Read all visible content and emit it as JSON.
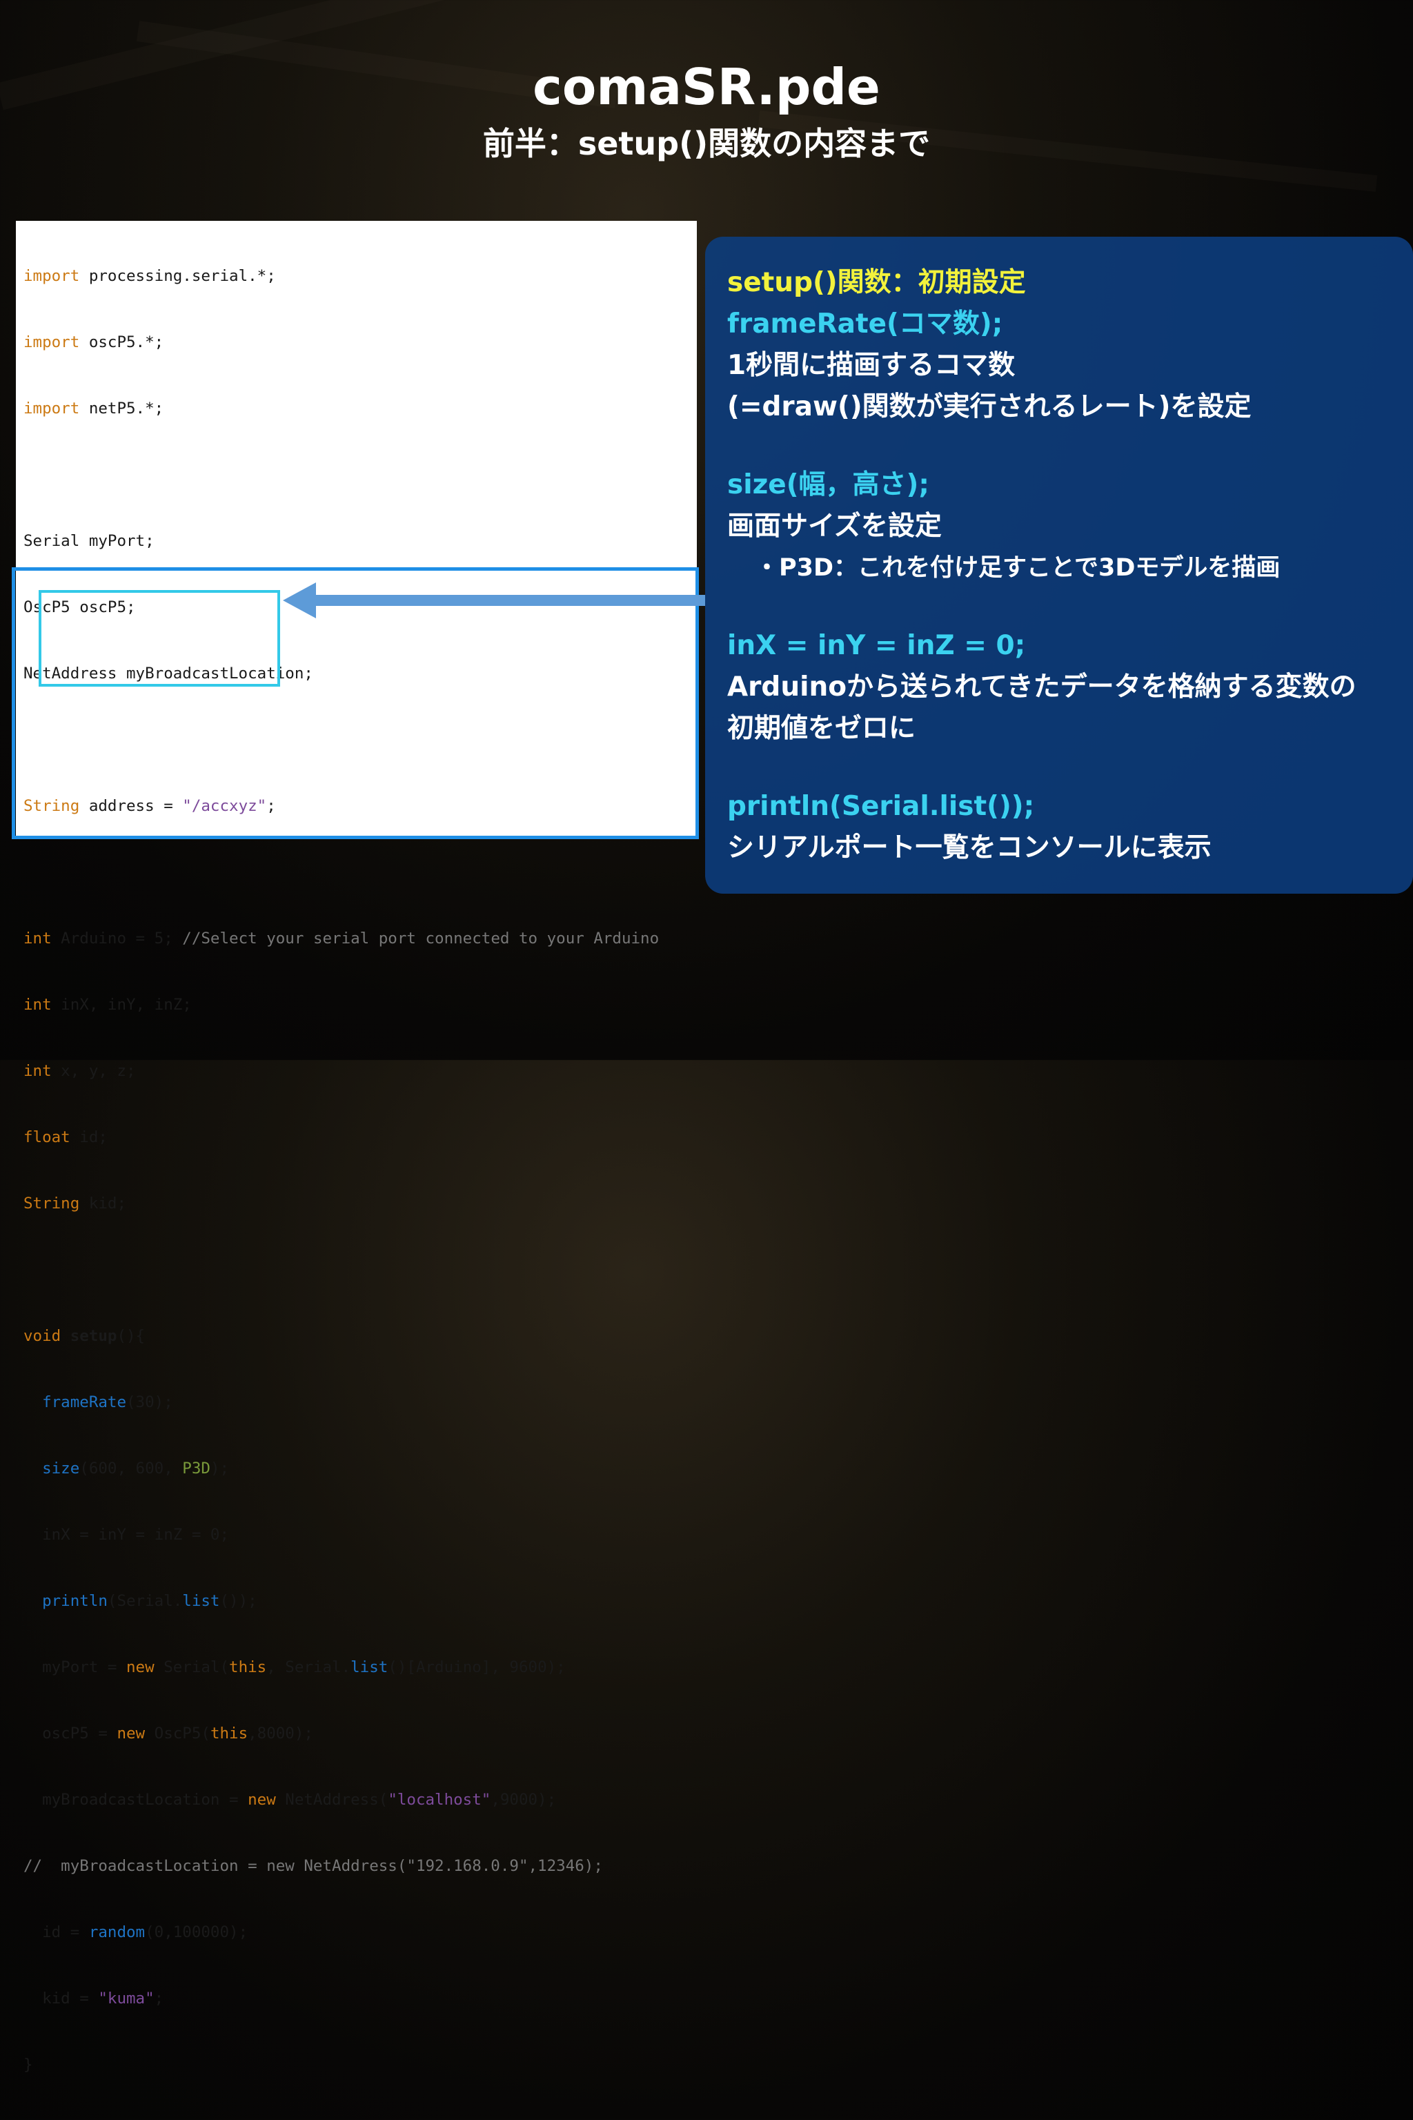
{
  "title": "comaSR.pde",
  "subtitle": "前半：setup()関数の内容まで",
  "code": {
    "l1": {
      "kw": "import",
      "rest": " processing.serial.*;"
    },
    "l2": {
      "kw": "import",
      "rest": " oscP5.*;"
    },
    "l3": {
      "kw": "import",
      "rest": " netP5.*;"
    },
    "l5": "Serial myPort;",
    "l6": "OscP5 oscP5;",
    "l7": "NetAddress myBroadcastLocation;",
    "l9": {
      "kw": "String",
      "mid": " address = ",
      "str": "\"/accxyz\"",
      "end": ";"
    },
    "l11": {
      "kw": "int",
      "mid": " Arduino = 5; ",
      "comment": "//Select your serial port connected to your Arduino"
    },
    "l12": {
      "kw": "int",
      "rest": " inX, inY, inZ;"
    },
    "l13": {
      "kw": "int",
      "rest": " x, y, z;"
    },
    "l14": {
      "kw": "float",
      "rest": " id;"
    },
    "l15": {
      "kw": "String",
      "rest": " kid;"
    },
    "l17": {
      "kw": "void",
      "fn": "setup",
      "rest": "(){"
    },
    "l18": {
      "fn": "frameRate",
      "rest": "(30);"
    },
    "l19": {
      "fn": "size",
      "mid": "(600, 600, ",
      "lit": "P3D",
      "end": ");"
    },
    "l20": "inX = inY = inZ = 0;",
    "l21": {
      "fn": "println",
      "mid": "(Serial.",
      "fn2": "list",
      "end": "());"
    },
    "l22": {
      "a": "myPort = ",
      "kw": "new",
      "b": " Serial(",
      "kw2": "this",
      "c": ", Serial.",
      "fn": "list",
      "d": "()[Arduino], 9600);"
    },
    "l23": {
      "a": "oscP5 = ",
      "kw": "new",
      "b": " OscP5(",
      "kw2": "this",
      "c": ",8000);"
    },
    "l24": {
      "a": "myBroadcastLocation = ",
      "kw": "new",
      "b": " NetAddress(",
      "str": "\"localhost\"",
      "c": ",9000);"
    },
    "l25": "//  myBroadcastLocation = new NetAddress(\"192.168.0.9\",12346);",
    "l26": {
      "a": "id = ",
      "fn": "random",
      "b": "(0,100000);"
    },
    "l27": {
      "a": "kid = ",
      "str": "\"kuma\"",
      "b": ";"
    },
    "l28": "}"
  },
  "info": {
    "heading": "setup()関数：初期設定",
    "framerate_code": "frameRate(コマ数);",
    "framerate_desc1": "1秒間に描画するコマ数",
    "framerate_desc2": "(=draw()関数が実行されるレート)を設定",
    "size_code": "size(幅，高さ);",
    "size_desc": "画面サイズを設定",
    "size_note": "・P3D：これを付け足すことで3Dモデルを描画",
    "inxyz_code": "inX = inY = inZ = 0;",
    "inxyz_desc1": "Arduinoから送られてきたデータを格納する変数の",
    "inxyz_desc2": "初期値をゼロに",
    "println_code": "println(Serial.list());",
    "println_desc": "シリアルポート一覧をコンソールに表示"
  },
  "colors": {
    "code_keyword": "#cc7a14",
    "code_function": "#1e73c4",
    "setup_box_border": "#1f8fe6",
    "inner_box_border": "#33c9e8",
    "info_panel_bg": "#0c3e80",
    "heading_yellow": "#f2f23c",
    "code_cyan": "#3bd2f0"
  }
}
